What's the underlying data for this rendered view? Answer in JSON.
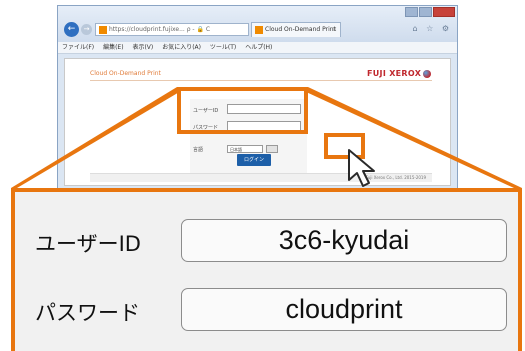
{
  "browser": {
    "address": "https://cloudprint.fujixe... ρ - 🔒 C",
    "tab_title": "Cloud On-Demand Print",
    "tab_close": "×",
    "tools": "⌂ ☆ ⚙",
    "nav_back": "←",
    "nav_forward": "→",
    "menu": [
      "ファイル(F)",
      "編集(E)",
      "表示(V)",
      "お気に入り(A)",
      "ツール(T)",
      "ヘルプ(H)"
    ]
  },
  "page": {
    "title": "Cloud On-Demand Print",
    "logo_text": "FUJI XEROX",
    "userid_label_small": "ユーザーID",
    "password_label_small": "パスワード",
    "language_label_small": "言語",
    "language_value_small": "日本語",
    "login_button": "ログイン",
    "copyright": "© Fuji Xerox Co., Ltd. 2015-2019"
  },
  "zoom": {
    "userid_label": "ユーザーID",
    "userid_value": "3c6-kyudai",
    "password_label": "パスワード",
    "password_value": "cloudprint"
  },
  "colors": {
    "highlight": "#e8760f",
    "login_button": "#1d5fa8",
    "logo": "#c0282e"
  }
}
